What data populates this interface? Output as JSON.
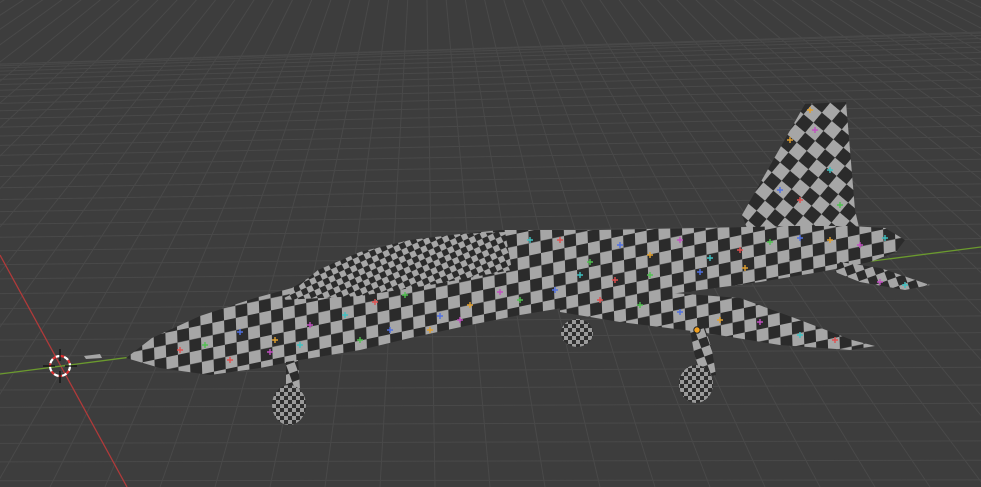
{
  "viewport": {
    "background_color": "#3d3d3d",
    "grid_color": "#494949",
    "x_axis_color": "#b03a3a",
    "y_axis_color": "#6b9a2e",
    "checker_light": "#a6a6a6",
    "checker_dark": "#2b2b2b",
    "origin_point_color": "#f0a020",
    "cursor_ring_colors": [
      "#ffffff",
      "#e03030"
    ]
  },
  "scene": {
    "object": "aircraft-mesh",
    "texture": "uv-checker-grid",
    "uv_marker_colors": [
      "#e05050",
      "#50c050",
      "#5070e0",
      "#e0a030",
      "#c050c0",
      "#40c0c0"
    ]
  },
  "cursor": {
    "icon": "3d-cursor-icon"
  }
}
